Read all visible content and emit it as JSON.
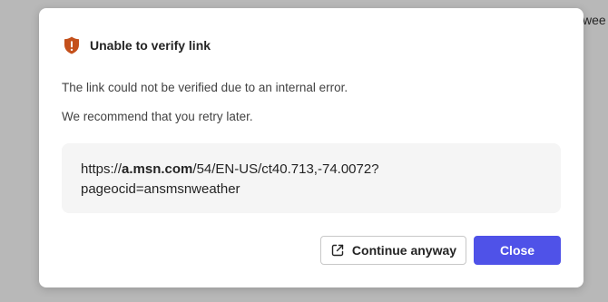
{
  "background": {
    "partial_text": "wee"
  },
  "dialog": {
    "title": "Unable to verify link",
    "icon": "shield-warning-icon",
    "message_1": "The link could not be verified due to an internal error.",
    "message_2": "We recommend that you retry later.",
    "url": {
      "prefix": "https://",
      "domain": "a.msn.com",
      "path_line1": "/54/EN-US/ct40.713,-74.0072?",
      "path_line2": "pageocid=ansmsnweather"
    },
    "buttons": {
      "continue_label": "Continue anyway",
      "close_label": "Close"
    },
    "colors": {
      "warning": "#c4501b",
      "primary": "#4f52e8"
    }
  }
}
